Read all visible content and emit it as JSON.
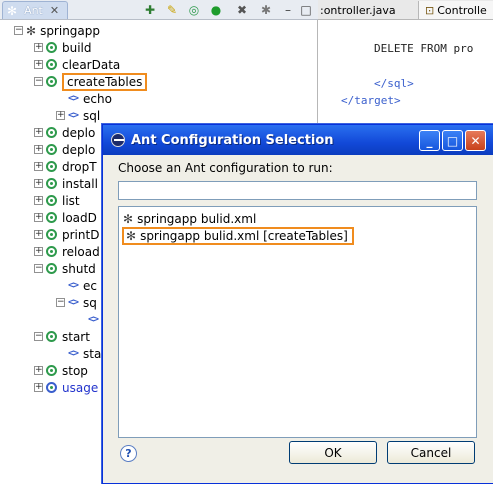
{
  "ant_view": {
    "tab_label": "Ant",
    "toolbar_icons": [
      "add-buildfile-icon",
      "search-buildfiles-icon",
      "hide-internal-targets-icon",
      "run-icon",
      "stop-icon",
      "remove-icon",
      "remove-all-icon",
      "minimize-icon",
      "maximize-icon"
    ],
    "toolbar_minimize": "–",
    "toolbar_maximize": "□",
    "tree": {
      "root": "springapp",
      "rows": [
        {
          "label": "build",
          "kind": "target",
          "expander": "+"
        },
        {
          "label": "clearData",
          "kind": "target",
          "expander": "+"
        },
        {
          "label": "createTables",
          "kind": "target",
          "expander": "−",
          "highlighted": true
        },
        {
          "label": "echo",
          "kind": "task",
          "expander": ""
        },
        {
          "label": "sql",
          "kind": "task",
          "expander": "+"
        },
        {
          "label": "deplo",
          "kind": "target",
          "expander": "+"
        },
        {
          "label": "deplo",
          "kind": "target",
          "expander": "+"
        },
        {
          "label": "dropT",
          "kind": "target",
          "expander": "+"
        },
        {
          "label": "install",
          "kind": "target",
          "expander": "+"
        },
        {
          "label": "list",
          "kind": "target",
          "expander": "+"
        },
        {
          "label": "loadD",
          "kind": "target",
          "expander": "+"
        },
        {
          "label": "printD",
          "kind": "target",
          "expander": "+"
        },
        {
          "label": "reload",
          "kind": "target",
          "expander": "+"
        },
        {
          "label": "shutd",
          "kind": "target",
          "expander": "−"
        },
        {
          "label": "ec",
          "kind": "task",
          "expander": ""
        },
        {
          "label": "sq",
          "kind": "task",
          "expander": "−"
        },
        {
          "label": "",
          "kind": "task",
          "expander": ""
        },
        {
          "label": "start",
          "kind": "target",
          "expander": "−"
        },
        {
          "label": "sta",
          "kind": "task",
          "expander": ""
        },
        {
          "label": "stop",
          "kind": "target",
          "expander": "+"
        },
        {
          "label": "usage",
          "kind": "default-target",
          "expander": "+"
        }
      ]
    }
  },
  "editor": {
    "tabs": [
      {
        "label": ":ontroller.java"
      },
      {
        "label": "Controlle"
      }
    ],
    "code_lines": [
      {
        "text": "DELETE FROM pro",
        "kind": "text"
      },
      {
        "text": "</sql>",
        "kind": "tag"
      },
      {
        "text": "</target>",
        "kind": "tag"
      }
    ]
  },
  "dialog": {
    "title": "Ant Configuration Selection",
    "prompt": "Choose an Ant configuration to run:",
    "filter_value": "",
    "items": [
      {
        "label": "springapp bulid.xml",
        "selected": false
      },
      {
        "label": "springapp bulid.xml [createTables]",
        "selected": true
      }
    ],
    "ok_label": "OK",
    "cancel_label": "Cancel",
    "help_glyph": "?",
    "window_buttons": {
      "minimize": "_",
      "maximize": "□",
      "close": "✕"
    }
  }
}
